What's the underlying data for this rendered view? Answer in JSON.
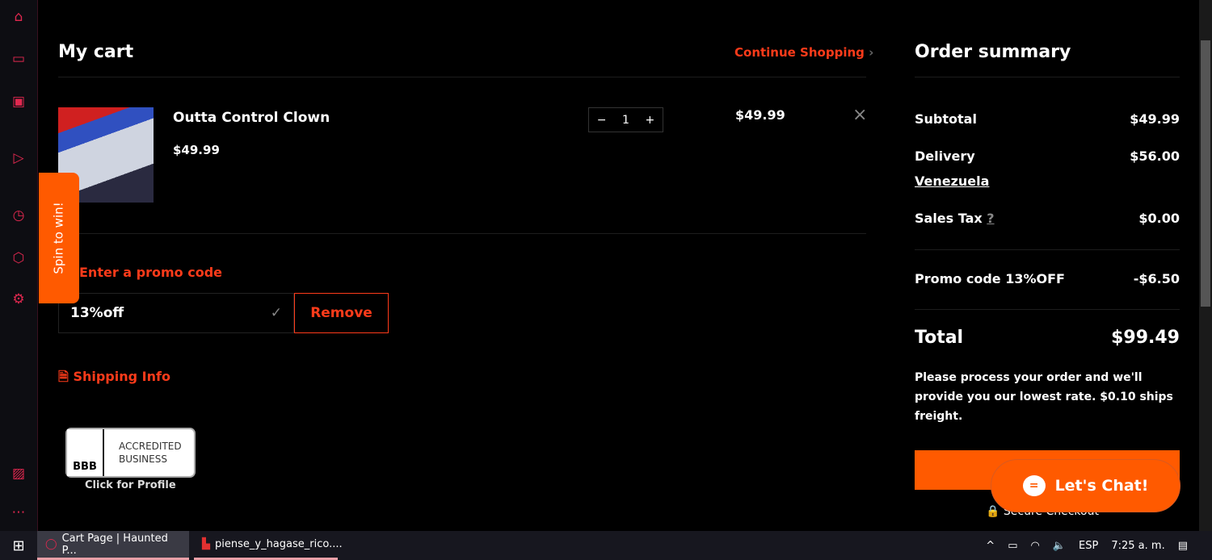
{
  "sidebar": {
    "icons": [
      "store-icon",
      "twitch-icon",
      "chip-icon",
      "play-icon",
      "clock-icon",
      "box-icon",
      "gear-icon",
      "gallery-icon",
      "more-icon"
    ]
  },
  "spin": {
    "label": "Spin to win!"
  },
  "cart": {
    "title": "My cart",
    "continue": "Continue Shopping",
    "item": {
      "name": "Outta Control Clown",
      "price": "$49.99",
      "qty": "1",
      "total": "$49.99"
    },
    "promo": {
      "label": "Enter a promo code",
      "value": "13%off",
      "remove": "Remove"
    },
    "shipping": "Shipping Info",
    "bbb": {
      "line1": "ACCREDITED",
      "line2": "BUSINESS",
      "caption": "Click for Profile",
      "logo": "BBB"
    }
  },
  "summary": {
    "title": "Order summary",
    "subtotal_label": "Subtotal",
    "subtotal": "$49.99",
    "delivery_label": "Delivery",
    "delivery": "$56.00",
    "country": "Venezuela",
    "tax_label": "Sales Tax",
    "tax_help": "?",
    "tax": "$0.00",
    "promo_label": "Promo code 13%OFF",
    "promo": "-$6.50",
    "total_label": "Total",
    "total": "$99.49",
    "note": "Please process your order and we'll provide you our lowest rate. $0.10 ships freight.",
    "secure": "Secure Checkout"
  },
  "chat": {
    "label": "Let's Chat!"
  },
  "taskbar": {
    "tab1": "Cart Page | Haunted P...",
    "tab2": "piense_y_hagase_rico....",
    "lang": "ESP",
    "time": "7:25 a. m."
  },
  "colors": {
    "accent": "#ff3b1a",
    "button": "#ff5a00",
    "sidebar_icon": "#e0284f"
  }
}
